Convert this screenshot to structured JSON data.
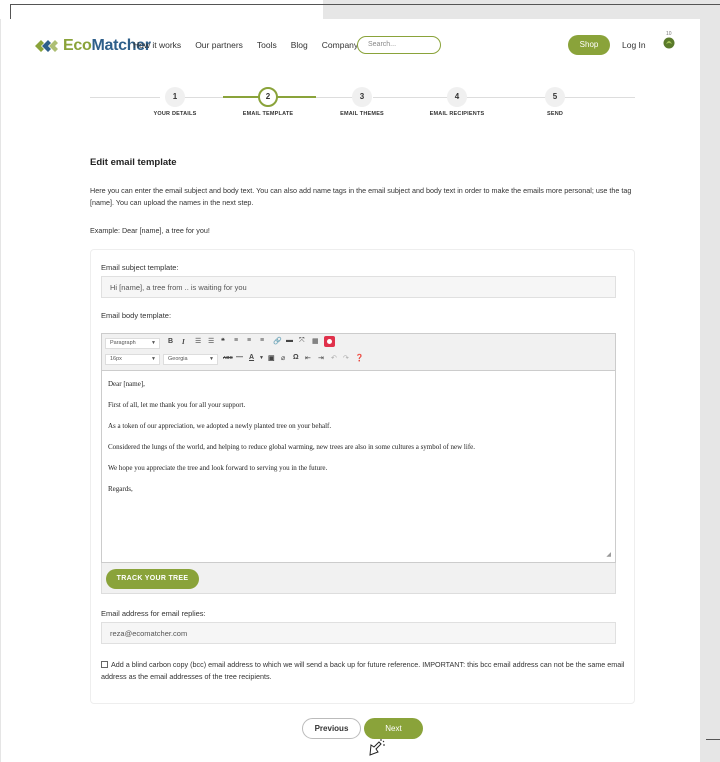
{
  "header": {
    "logo_text_eco": "Eco",
    "logo_text_rest": "Matcher",
    "nav": [
      "How it works",
      "Our partners",
      "Tools",
      "Blog",
      "Company"
    ],
    "search_placeholder": "Search...",
    "shop_label": "Shop",
    "login_label": "Log In",
    "badge_count": "10",
    "brand_color": "#8aa33a"
  },
  "stepper": {
    "steps": [
      {
        "number": "1",
        "label": "YOUR DETAILS"
      },
      {
        "number": "2",
        "label": "EMAIL TEMPLATE"
      },
      {
        "number": "3",
        "label": "EMAIL THEMES"
      },
      {
        "number": "4",
        "label": "EMAIL RECIPIENTS"
      },
      {
        "number": "5",
        "label": "SEND"
      }
    ],
    "active_step": "2"
  },
  "main": {
    "title": "Edit email template",
    "intro": "Here you can enter the email subject and body text. You can also add name tags in the email subject and body text in order to make the emails more personal; use the tag [name]. You can upload the names in the next step.",
    "example": "Example: Dear [name], a tree for you!"
  },
  "form": {
    "subject_label": "Email subject template:",
    "subject_value": "Hi [name], a tree from .. is waiting for you",
    "body_label": "Email body template:",
    "toolbar": {
      "format_select": "Paragraph",
      "size_select": "16px",
      "font_select": "Georgia"
    },
    "body_paragraphs": [
      "Dear [name],",
      "First of all, let me thank you for all your support.",
      "As a token of our appreciation, we adopted a newly planted tree on your behalf.",
      "Considered the lungs of the world, and helping to reduce global warming, new trees are also in some cultures a symbol of new life.",
      "We hope you appreciate the tree and look forward to serving you in the future.",
      "Regards,"
    ],
    "track_button": "TRACK YOUR TREE",
    "reply_label": "Email address for email replies:",
    "reply_value": "reza@ecomatcher.com",
    "bcc_text": "Add a blind carbon copy (bcc) email address to which we will send a back up for future reference. IMPORTANT: this bcc email address can not be the same email address as the email addresses of the tree recipients."
  },
  "nav_buttons": {
    "previous": "Previous",
    "next": "Next"
  }
}
